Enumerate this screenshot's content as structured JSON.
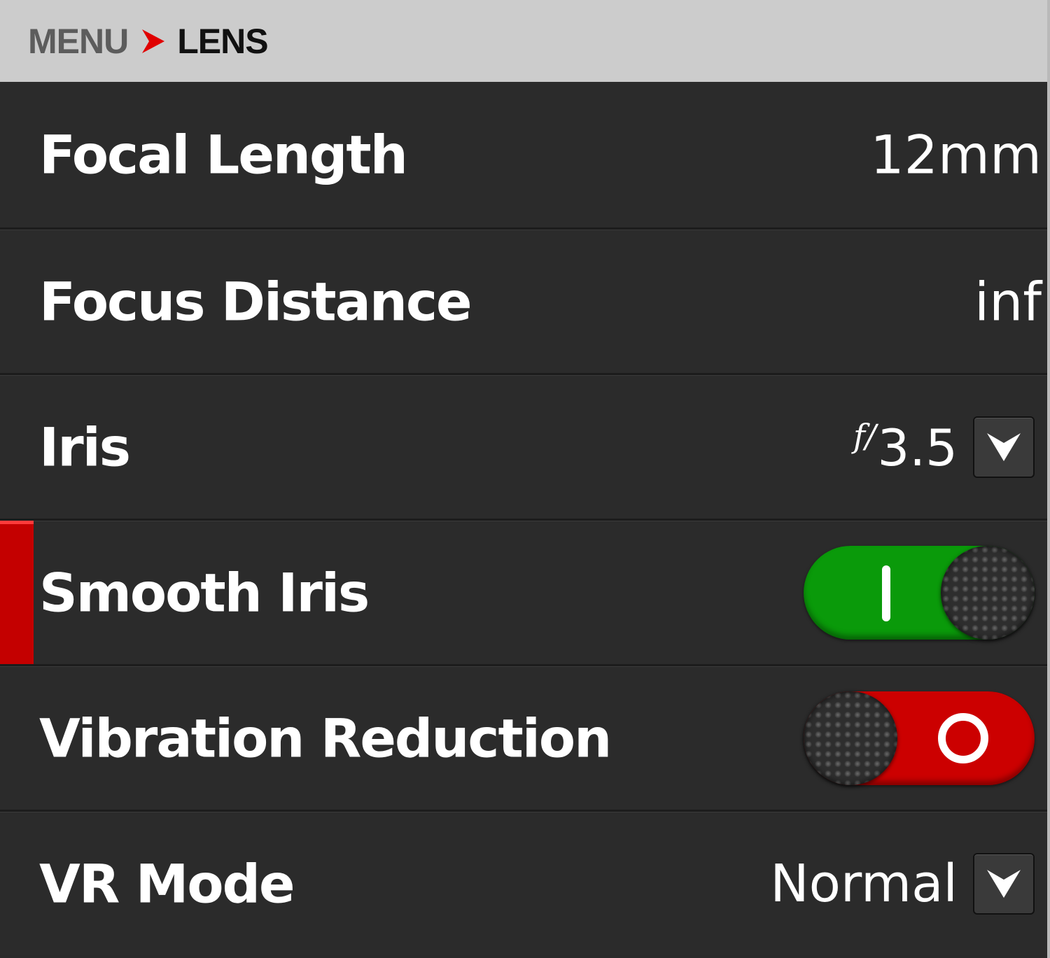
{
  "breadcrumb": {
    "root": "MENU",
    "current": "LENS"
  },
  "rows": [
    {
      "label": "Focal Length",
      "value": "12mm"
    },
    {
      "label": "Focus Distance",
      "value": "inf"
    },
    {
      "label": "Iris",
      "value_prefix": "f/",
      "value": "3.5",
      "control": "dropdown"
    },
    {
      "label": "Smooth Iris",
      "control": "toggle",
      "state": "on",
      "selected": true
    },
    {
      "label": "Vibration Reduction",
      "control": "toggle",
      "state": "off"
    },
    {
      "label": "VR Mode",
      "value": "Normal",
      "control": "dropdown"
    }
  ],
  "colors": {
    "accent_red": "#c40000",
    "toggle_on": "#0a9a0a",
    "toggle_off": "#cc0000",
    "row_background": "#2b2b2b",
    "header_background": "#cccccc"
  },
  "icons": {
    "breadcrumb_separator": "chevron-right-icon",
    "dropdown": "chevron-down-icon"
  }
}
